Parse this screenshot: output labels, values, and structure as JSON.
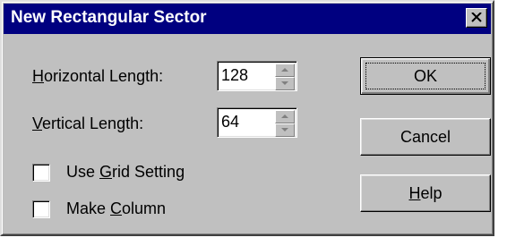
{
  "window": {
    "title": "New Rectangular Sector",
    "close_glyph": "close-icon"
  },
  "fields": {
    "horizontal_length": {
      "label_mnemonic": "H",
      "label_rest": "orizontal Length:",
      "value": "128"
    },
    "vertical_length": {
      "label_mnemonic": "V",
      "label_rest": "ertical Length:",
      "value": "64"
    }
  },
  "checkboxes": {
    "use_grid_setting": {
      "label_before": "Use ",
      "label_mnemonic": "G",
      "label_after": "rid Setting",
      "checked": false
    },
    "make_column": {
      "label_before": "Make ",
      "label_mnemonic": "C",
      "label_after": "olumn",
      "checked": false
    }
  },
  "buttons": {
    "ok_label": "OK",
    "cancel_label": "Cancel",
    "help_mnemonic": "H",
    "help_rest": "elp"
  },
  "colors": {
    "titlebar": "#000080",
    "face": "#c0c0c0"
  }
}
